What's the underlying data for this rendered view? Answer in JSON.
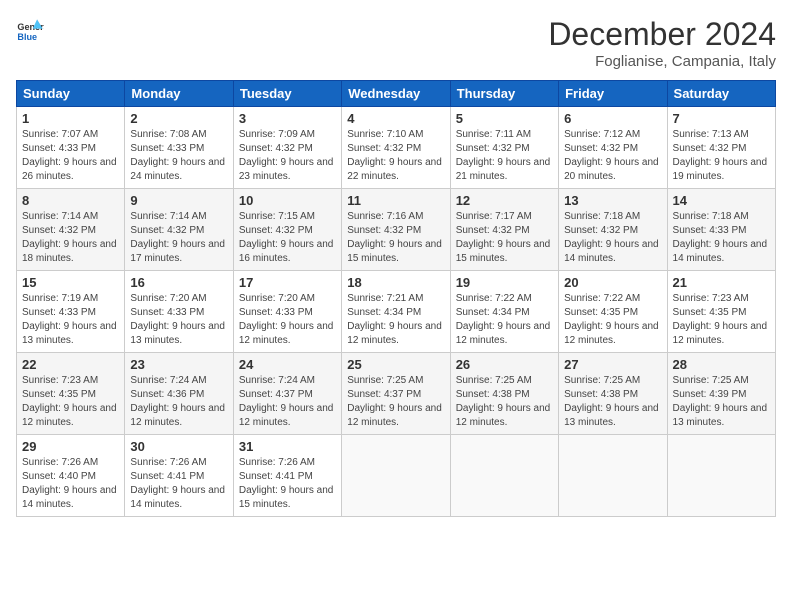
{
  "header": {
    "logo_general": "General",
    "logo_blue": "Blue",
    "month_year": "December 2024",
    "location": "Foglianise, Campania, Italy"
  },
  "weekdays": [
    "Sunday",
    "Monday",
    "Tuesday",
    "Wednesday",
    "Thursday",
    "Friday",
    "Saturday"
  ],
  "weeks": [
    [
      {
        "day": "1",
        "sunrise": "Sunrise: 7:07 AM",
        "sunset": "Sunset: 4:33 PM",
        "daylight": "Daylight: 9 hours and 26 minutes."
      },
      {
        "day": "2",
        "sunrise": "Sunrise: 7:08 AM",
        "sunset": "Sunset: 4:33 PM",
        "daylight": "Daylight: 9 hours and 24 minutes."
      },
      {
        "day": "3",
        "sunrise": "Sunrise: 7:09 AM",
        "sunset": "Sunset: 4:32 PM",
        "daylight": "Daylight: 9 hours and 23 minutes."
      },
      {
        "day": "4",
        "sunrise": "Sunrise: 7:10 AM",
        "sunset": "Sunset: 4:32 PM",
        "daylight": "Daylight: 9 hours and 22 minutes."
      },
      {
        "day": "5",
        "sunrise": "Sunrise: 7:11 AM",
        "sunset": "Sunset: 4:32 PM",
        "daylight": "Daylight: 9 hours and 21 minutes."
      },
      {
        "day": "6",
        "sunrise": "Sunrise: 7:12 AM",
        "sunset": "Sunset: 4:32 PM",
        "daylight": "Daylight: 9 hours and 20 minutes."
      },
      {
        "day": "7",
        "sunrise": "Sunrise: 7:13 AM",
        "sunset": "Sunset: 4:32 PM",
        "daylight": "Daylight: 9 hours and 19 minutes."
      }
    ],
    [
      {
        "day": "8",
        "sunrise": "Sunrise: 7:14 AM",
        "sunset": "Sunset: 4:32 PM",
        "daylight": "Daylight: 9 hours and 18 minutes."
      },
      {
        "day": "9",
        "sunrise": "Sunrise: 7:14 AM",
        "sunset": "Sunset: 4:32 PM",
        "daylight": "Daylight: 9 hours and 17 minutes."
      },
      {
        "day": "10",
        "sunrise": "Sunrise: 7:15 AM",
        "sunset": "Sunset: 4:32 PM",
        "daylight": "Daylight: 9 hours and 16 minutes."
      },
      {
        "day": "11",
        "sunrise": "Sunrise: 7:16 AM",
        "sunset": "Sunset: 4:32 PM",
        "daylight": "Daylight: 9 hours and 15 minutes."
      },
      {
        "day": "12",
        "sunrise": "Sunrise: 7:17 AM",
        "sunset": "Sunset: 4:32 PM",
        "daylight": "Daylight: 9 hours and 15 minutes."
      },
      {
        "day": "13",
        "sunrise": "Sunrise: 7:18 AM",
        "sunset": "Sunset: 4:32 PM",
        "daylight": "Daylight: 9 hours and 14 minutes."
      },
      {
        "day": "14",
        "sunrise": "Sunrise: 7:18 AM",
        "sunset": "Sunset: 4:33 PM",
        "daylight": "Daylight: 9 hours and 14 minutes."
      }
    ],
    [
      {
        "day": "15",
        "sunrise": "Sunrise: 7:19 AM",
        "sunset": "Sunset: 4:33 PM",
        "daylight": "Daylight: 9 hours and 13 minutes."
      },
      {
        "day": "16",
        "sunrise": "Sunrise: 7:20 AM",
        "sunset": "Sunset: 4:33 PM",
        "daylight": "Daylight: 9 hours and 13 minutes."
      },
      {
        "day": "17",
        "sunrise": "Sunrise: 7:20 AM",
        "sunset": "Sunset: 4:33 PM",
        "daylight": "Daylight: 9 hours and 12 minutes."
      },
      {
        "day": "18",
        "sunrise": "Sunrise: 7:21 AM",
        "sunset": "Sunset: 4:34 PM",
        "daylight": "Daylight: 9 hours and 12 minutes."
      },
      {
        "day": "19",
        "sunrise": "Sunrise: 7:22 AM",
        "sunset": "Sunset: 4:34 PM",
        "daylight": "Daylight: 9 hours and 12 minutes."
      },
      {
        "day": "20",
        "sunrise": "Sunrise: 7:22 AM",
        "sunset": "Sunset: 4:35 PM",
        "daylight": "Daylight: 9 hours and 12 minutes."
      },
      {
        "day": "21",
        "sunrise": "Sunrise: 7:23 AM",
        "sunset": "Sunset: 4:35 PM",
        "daylight": "Daylight: 9 hours and 12 minutes."
      }
    ],
    [
      {
        "day": "22",
        "sunrise": "Sunrise: 7:23 AM",
        "sunset": "Sunset: 4:35 PM",
        "daylight": "Daylight: 9 hours and 12 minutes."
      },
      {
        "day": "23",
        "sunrise": "Sunrise: 7:24 AM",
        "sunset": "Sunset: 4:36 PM",
        "daylight": "Daylight: 9 hours and 12 minutes."
      },
      {
        "day": "24",
        "sunrise": "Sunrise: 7:24 AM",
        "sunset": "Sunset: 4:37 PM",
        "daylight": "Daylight: 9 hours and 12 minutes."
      },
      {
        "day": "25",
        "sunrise": "Sunrise: 7:25 AM",
        "sunset": "Sunset: 4:37 PM",
        "daylight": "Daylight: 9 hours and 12 minutes."
      },
      {
        "day": "26",
        "sunrise": "Sunrise: 7:25 AM",
        "sunset": "Sunset: 4:38 PM",
        "daylight": "Daylight: 9 hours and 12 minutes."
      },
      {
        "day": "27",
        "sunrise": "Sunrise: 7:25 AM",
        "sunset": "Sunset: 4:38 PM",
        "daylight": "Daylight: 9 hours and 13 minutes."
      },
      {
        "day": "28",
        "sunrise": "Sunrise: 7:25 AM",
        "sunset": "Sunset: 4:39 PM",
        "daylight": "Daylight: 9 hours and 13 minutes."
      }
    ],
    [
      {
        "day": "29",
        "sunrise": "Sunrise: 7:26 AM",
        "sunset": "Sunset: 4:40 PM",
        "daylight": "Daylight: 9 hours and 14 minutes."
      },
      {
        "day": "30",
        "sunrise": "Sunrise: 7:26 AM",
        "sunset": "Sunset: 4:41 PM",
        "daylight": "Daylight: 9 hours and 14 minutes."
      },
      {
        "day": "31",
        "sunrise": "Sunrise: 7:26 AM",
        "sunset": "Sunset: 4:41 PM",
        "daylight": "Daylight: 9 hours and 15 minutes."
      },
      null,
      null,
      null,
      null
    ]
  ]
}
